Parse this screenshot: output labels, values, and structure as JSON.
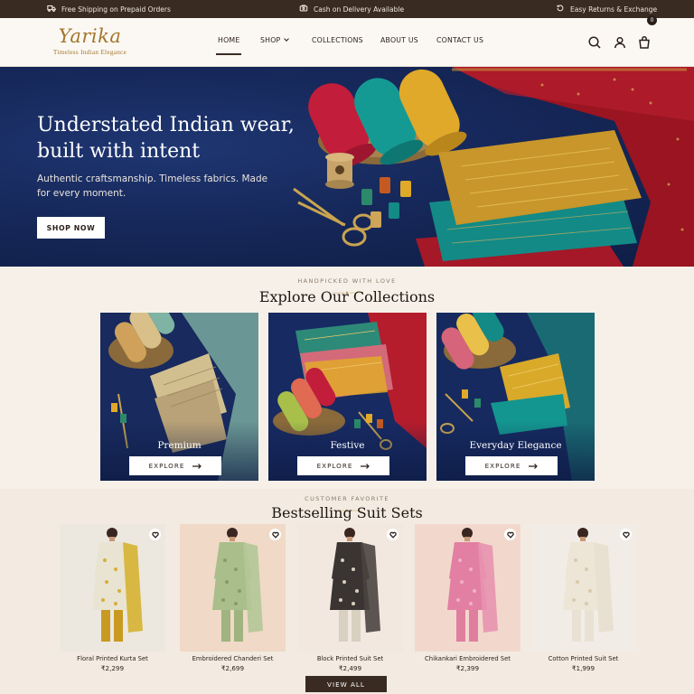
{
  "announcement": {
    "shipping": "Free Shipping on Prepaid Orders",
    "cod": "Cash on Delivery Available",
    "returns": "Easy Returns & Exchange"
  },
  "header": {
    "brand": "Yarika",
    "tagline": "Timeless Indian Elegance",
    "nav": [
      "HOME",
      "SHOP",
      "COLLECTIONS",
      "ABOUT US",
      "CONTACT US"
    ],
    "active_nav": "HOME",
    "cart_count": "0"
  },
  "hero": {
    "title": "Understated Indian wear, built with intent",
    "subtitle": "Authentic craftsmanship. Timeless fabrics. Made for every moment.",
    "cta": "SHOP NOW"
  },
  "collections": {
    "eyebrow": "HANDPICKED WITH LOVE",
    "title": "Explore Our Collections",
    "items": [
      {
        "label": "Premium",
        "button": "EXPLORE"
      },
      {
        "label": "Festive",
        "button": "EXPLORE"
      },
      {
        "label": "Everyday Elegance",
        "button": "EXPLORE"
      }
    ]
  },
  "bestsellers": {
    "eyebrow": "CUSTOMER FAVORITE",
    "title": "Bestselling Suit Sets",
    "products": [
      {
        "name": "Floral Printed Kurta Set",
        "price": "₹2,299"
      },
      {
        "name": "Embroidered Chanderi Set",
        "price": "₹2,699"
      },
      {
        "name": "Block Printed Suit Set",
        "price": "₹2,499"
      },
      {
        "name": "Chikankari Embroidered Set",
        "price": "₹2,399"
      },
      {
        "name": "Cotton Printed Suit Set",
        "price": "₹1,999"
      }
    ],
    "view_all": "VIEW ALL"
  },
  "colors": {
    "topbar": "#3a2b22",
    "brand_gold": "#a4762c",
    "hero_navy": "#16285a",
    "page_bg": "#f6f0e8"
  },
  "icons": [
    "truck-icon",
    "cash-icon",
    "return-icon",
    "search-icon",
    "user-icon",
    "bag-icon",
    "heart-icon",
    "arrow-right-icon"
  ]
}
